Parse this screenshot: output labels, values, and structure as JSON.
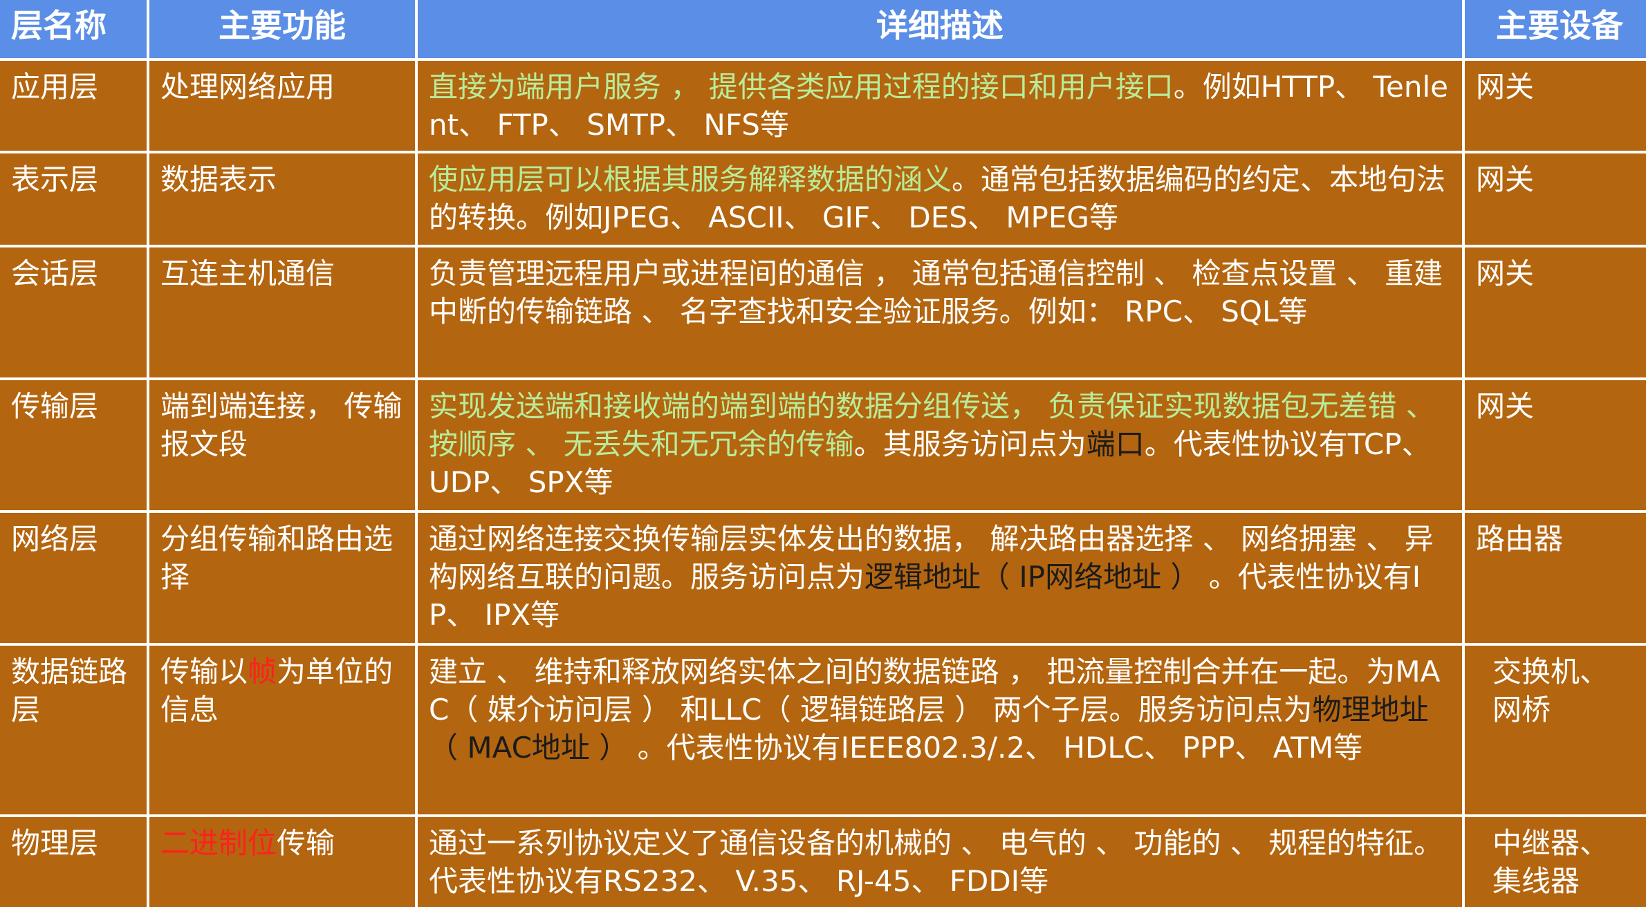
{
  "headers": [
    "层名称",
    "主要功能",
    "详细描述",
    "主要设备"
  ],
  "rows": [
    {
      "name": "应用层",
      "function": [
        {
          "text": "处理网络应用",
          "style": "plain"
        }
      ],
      "description": [
        {
          "text": "直接为端用户服务 ， 提供各类应用过程的接口和用户接口",
          "style": "green"
        },
        {
          "text": "。例如HTTP、 Tenlent、 FTP、 SMTP、 NFS等",
          "style": "plain"
        }
      ],
      "device": "网关"
    },
    {
      "name": "表示层",
      "function": [
        {
          "text": "数据表示",
          "style": "plain"
        }
      ],
      "description": [
        {
          "text": "使应用层可以根据其服务解释数据的涵义",
          "style": "green"
        },
        {
          "text": "。通常包括数据编码的约定、本地句法的转换。例如JPEG、 ASCII、 GIF、 DES、 MPEG等",
          "style": "plain"
        }
      ],
      "device": "网关"
    },
    {
      "name": "会话层",
      "function": [
        {
          "text": "互连主机通信",
          "style": "plain"
        }
      ],
      "description": [
        {
          "text": "负责管理远程用户或进程间的通信 ， 通常包括通信控制 、 检查点设置 、 重建中断的传输链路 、 名字查找和安全验证服务。例如： RPC、 SQL等",
          "style": "plain"
        }
      ],
      "device": "网关"
    },
    {
      "name": "传输层",
      "function": [
        {
          "text": "端到端连接， 传输报文段",
          "style": "plain"
        }
      ],
      "description": [
        {
          "text": "实现发送端和接收端的端到端的数据分组传送， 负责保证实现数据包无差错 、 按顺序 、 无丢失和无冗余的传输",
          "style": "green"
        },
        {
          "text": "。其服务访问点为",
          "style": "plain"
        },
        {
          "text": "端口",
          "style": "dark"
        },
        {
          "text": "。代表性协议有TCP、 UDP、 SPX等",
          "style": "plain"
        }
      ],
      "device": "网关"
    },
    {
      "name": "网络层",
      "function": [
        {
          "text": "分组传输和路由选择",
          "style": "plain"
        }
      ],
      "description": [
        {
          "text": "通过网络连接交换传输层实体发出的数据， 解决路由器选择 、 网络拥塞 、 异构网络互联的问题。服务访问点为",
          "style": "plain"
        },
        {
          "text": "逻辑地址（ IP网络地址 ）",
          "style": "dark"
        },
        {
          "text": " 。代表性协议有IP、 IPX等",
          "style": "plain"
        }
      ],
      "device": "路由器"
    },
    {
      "name": "数据链路层",
      "function": [
        {
          "text": "传输以",
          "style": "plain"
        },
        {
          "text": "帧",
          "style": "red"
        },
        {
          "text": "为单位的信息",
          "style": "plain"
        }
      ],
      "description": [
        {
          "text": "建立 、 维持和释放网络实体之间的数据链路 ， 把流量控制合并在一起。为MAC（ 媒介访问层 ） 和LLC（ 逻辑链路层 ） 两个子层。服务访问点为",
          "style": "plain"
        },
        {
          "text": "物理地址（ MAC地址 ）",
          "style": "dark"
        },
        {
          "text": " 。代表性协议有IEEE802.3/.2、 HDLC、 PPP、 ATM等",
          "style": "plain"
        }
      ],
      "device": "交换机、 网桥"
    },
    {
      "name": "物理层",
      "function": [
        {
          "text": "二进制位",
          "style": "red"
        },
        {
          "text": "传输",
          "style": "plain"
        }
      ],
      "description": [
        {
          "text": "通过一系列协议定义了通信设备的机械的 、 电气的 、 功能的 、 规程的特征。代表性协议有RS232、 V.35、 RJ-45、 FDDI等",
          "style": "plain"
        }
      ],
      "device": "中继器、 集线器"
    }
  ]
}
